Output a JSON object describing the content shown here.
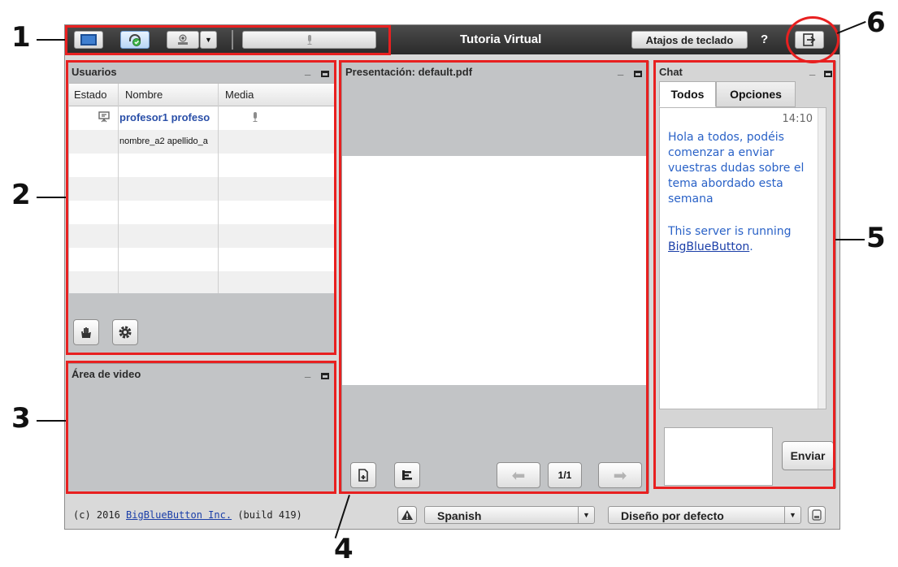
{
  "topbar": {
    "title": "Tutoria Virtual",
    "shortcuts_label": "Atajos de teclado",
    "help_label": "?"
  },
  "users_panel": {
    "title": "Usuarios",
    "columns": [
      "Estado",
      "Nombre",
      "Media"
    ],
    "rows": [
      {
        "name": "profesor1 profeso"
      },
      {
        "name": "nombre_a2 apellido_a"
      }
    ]
  },
  "video_panel": {
    "title": "Área de video"
  },
  "presentation_panel": {
    "title": "Presentación: default.pdf",
    "page_indicator": "1/1"
  },
  "chat_panel": {
    "title": "Chat",
    "tabs": [
      "Todos",
      "Opciones"
    ],
    "time": "14:10",
    "message": "Hola a todos, podéis comenzar a enviar vuestras dudas sobre el tema abordado esta semana",
    "server_prefix": "This server is running",
    "server_link": "BigBlueButton",
    "server_suffix": ".",
    "send_label": "Enviar"
  },
  "footer": {
    "copyright_prefix": "(c) 2016",
    "copyright_link": "BigBlueButton Inc.",
    "build": "(build 419)",
    "language": "Spanish",
    "layout": "Diseño por defecto"
  },
  "annotations": [
    "1",
    "2",
    "3",
    "4",
    "5",
    "6"
  ],
  "colors": {
    "highlight": "#e82020",
    "chat_text": "#2a62c7",
    "topbar": "#3a3a3a"
  }
}
